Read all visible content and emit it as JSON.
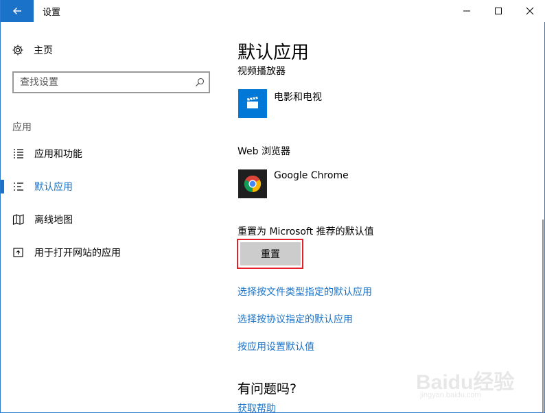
{
  "window": {
    "title": "设置",
    "controls": [
      "minimize",
      "maximize",
      "close"
    ]
  },
  "sidebar": {
    "home_label": "主页",
    "search_placeholder": "查找设置",
    "section_label": "应用",
    "items": [
      {
        "label": "应用和功能",
        "icon": "list-icon",
        "active": false
      },
      {
        "label": "默认应用",
        "icon": "default-apps-icon",
        "active": true
      },
      {
        "label": "离线地图",
        "icon": "map-icon",
        "active": false
      },
      {
        "label": "用于打开网站的应用",
        "icon": "open-website-icon",
        "active": false
      }
    ]
  },
  "main": {
    "title": "默认应用",
    "video_player": {
      "label": "视频播放器",
      "app_name": "电影和电视",
      "icon": "movies-tv-icon",
      "tile_color": "#0078d7"
    },
    "web_browser": {
      "label": "Web 浏览器",
      "app_name": "Google Chrome",
      "icon": "chrome-icon",
      "tile_color": "#1f1f1f"
    },
    "reset": {
      "label": "重置为 Microsoft 推荐的默认值",
      "button_label": "重置",
      "highlight_color": "#e4202a"
    },
    "links": [
      "选择按文件类型指定的默认应用",
      "选择按协议指定的默认应用",
      "按应用设置默认值"
    ],
    "help": {
      "title": "有问题吗?",
      "link": "获取帮助"
    }
  },
  "colors": {
    "accent": "#1a73c8",
    "title_bar_back": "#1a73c8"
  },
  "watermark": {
    "text": "Baidu经验",
    "sub": "jingyan.baidu.com"
  }
}
